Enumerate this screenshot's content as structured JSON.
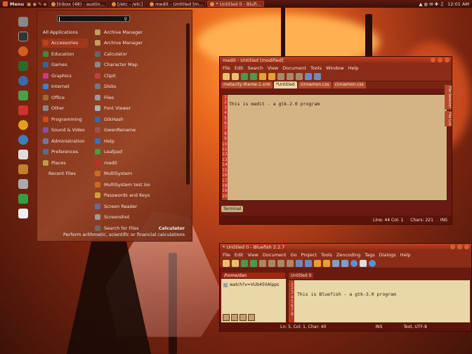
{
  "panel": {
    "menu_label": "Menu",
    "tasks": [
      {
        "label": "[Inbox (48) - austin...",
        "active": false
      },
      {
        "label": "[/etc - /etc]",
        "active": false
      },
      {
        "label": "medit - Untitled [m...",
        "active": false
      },
      {
        "label": "* Untitled 0 - Blufi...",
        "active": true
      }
    ],
    "clock": "12:01 AM"
  },
  "dock": {
    "icons": [
      "file-manager-icon",
      "terminal-icon",
      "settings-icon",
      "monitor-icon",
      "browser-icon",
      "app-icon",
      "editor-icon",
      "chrome-icon",
      "web-icon",
      "people-icon",
      "grid-icon",
      "display-icon",
      "exit-icon",
      "device-icon"
    ]
  },
  "menu": {
    "categories": [
      "All Applications",
      "Accessories",
      "Education",
      "Games",
      "Graphics",
      "Internet",
      "Office",
      "Other",
      "Programming",
      "Sound & Video",
      "Administration",
      "Preferences",
      "Places",
      "Recent Files"
    ],
    "apps": [
      "Archive Manager",
      "Archive Manager",
      "Calculator",
      "Character Map",
      "ClipIt",
      "Disks",
      "Files",
      "Font Viewer",
      "GtkHash",
      "GwenRename",
      "Help",
      "Leafpad",
      "medit",
      "MultiSystem",
      "MultiSystem test iso",
      "Passwords and Keys",
      "Screen Reader",
      "Screenshot",
      "Search for Files"
    ],
    "hover_title": "Calculator",
    "hover_desc": "Perform arithmetic, scientific or financial calculations"
  },
  "medit": {
    "title": "medit - Untitled [modified]",
    "menus": [
      "File",
      "Edit",
      "Search",
      "View",
      "Document",
      "Tools",
      "Window",
      "Help"
    ],
    "tabs": [
      "metacity-theme-1.xml",
      "*Untitled",
      "cinnamon.css",
      "cinnamon.css"
    ],
    "line_numbers": [
      "1",
      "2",
      "3",
      "4",
      "5",
      "6",
      "7",
      "8",
      "9",
      "10",
      "11",
      "12",
      "13",
      "14",
      "15",
      "16",
      "17",
      "18",
      "19",
      "20"
    ],
    "content": "This is medit - a gtk-2.0 program",
    "side_panels": [
      "File Selector",
      "File List"
    ],
    "terminal_tab": "Terminal",
    "status": {
      "position": "Line: 44 Col: 1",
      "chars": "Chars: 221",
      "mode": "INS"
    }
  },
  "bluefish": {
    "title": "* Untitled 0 - Bluefish 2.2.7",
    "menus": [
      "File",
      "Edit",
      "View",
      "Document",
      "Go",
      "Project",
      "Tools",
      "Zencoding",
      "Tags",
      "Dialogs",
      "Help"
    ],
    "path": "/home/dan",
    "file_item": "watch?v=VUb450Alpps",
    "tab": "Untitled 0",
    "line_numbers": [
      "1",
      "2",
      "3",
      "4",
      "5",
      "6",
      "7",
      "8"
    ],
    "content": "This is Bluefish - a gtk-3.0 program",
    "status": {
      "position": "Ln: 5, Col: 1, Char: 40",
      "mode": "INS",
      "encoding": "Text, UTF-8"
    }
  }
}
